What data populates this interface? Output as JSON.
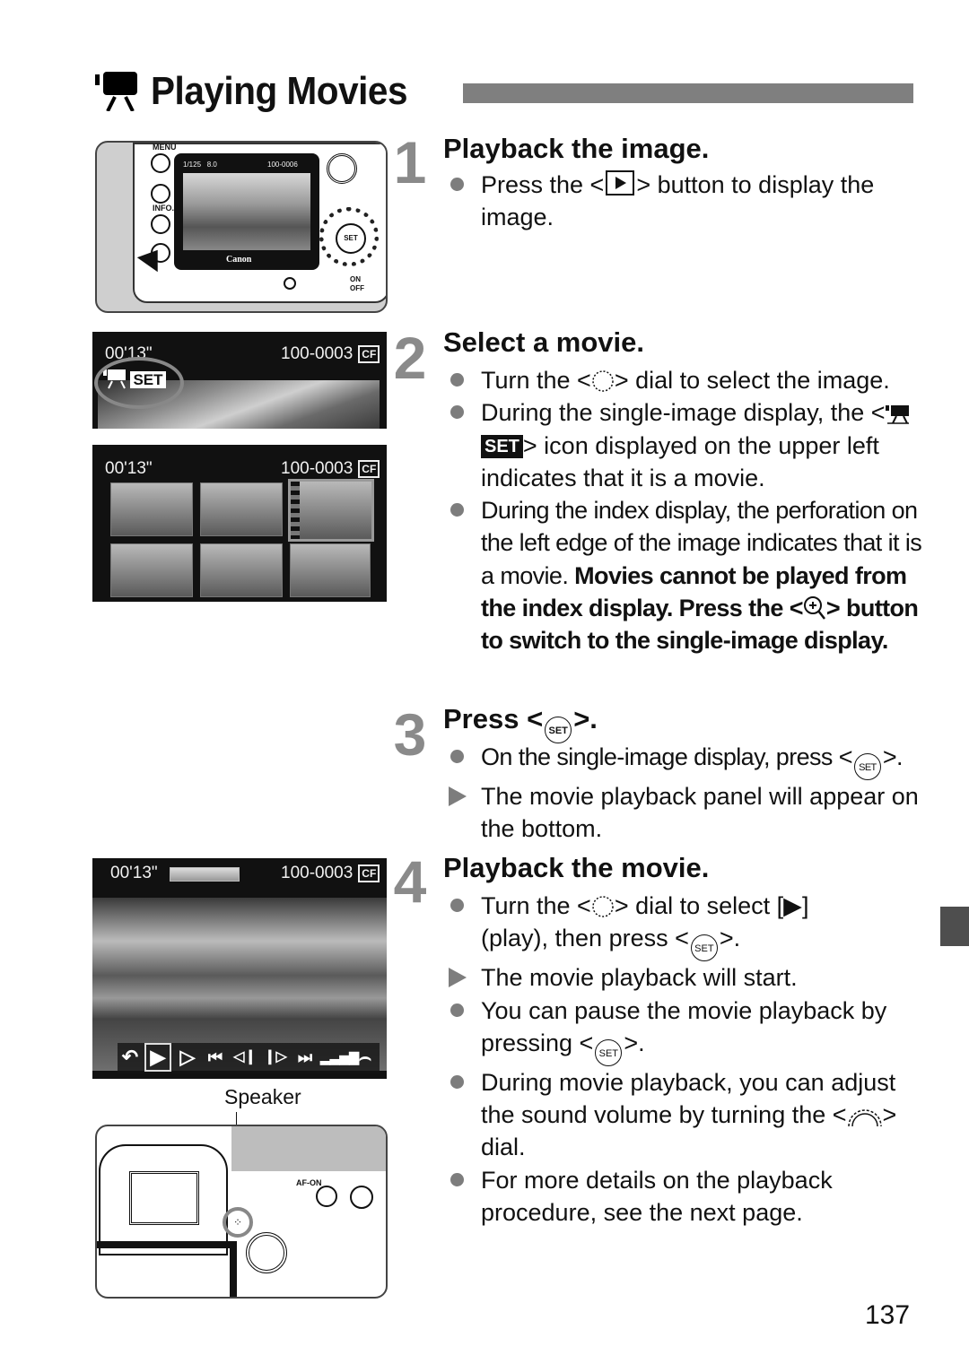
{
  "page": {
    "title": "Playing Movies",
    "title_icon": "movie-camera-icon",
    "page_number": "137",
    "accent_color": "#7f7f7f"
  },
  "steps": [
    {
      "number": "1",
      "heading": "Playback the image.",
      "items": [
        {
          "type": "bullet",
          "parts": [
            "Press the <",
            "play-button-icon",
            "> button to display the image."
          ]
        }
      ]
    },
    {
      "number": "2",
      "heading": "Select a movie.",
      "items": [
        {
          "type": "bullet",
          "parts": [
            "Turn the <",
            "quick-control-dial-icon",
            "> dial to select the image."
          ]
        },
        {
          "type": "bullet",
          "parts": [
            "During the single-image display, the <",
            "movie-set-icon",
            "> icon displayed on the upper left indicates that it is a movie."
          ]
        },
        {
          "type": "bullet",
          "text": "During the index display, the perforation on the left edge of the image indicates that it is a movie.",
          "bold_text_a": "Movies cannot be played from the index display. Press the <",
          "bold_text_b": "> button to switch to the single-image display."
        }
      ]
    },
    {
      "number": "3",
      "heading_a": "Press <",
      "heading_b": ">.",
      "items": [
        {
          "type": "bullet",
          "text_a": "On the single-image display, press <",
          "text_b": ">."
        },
        {
          "type": "arrow",
          "text": "The movie playback panel will appear on the bottom."
        }
      ]
    },
    {
      "number": "4",
      "heading": "Playback the movie.",
      "items": [
        {
          "type": "bullet",
          "text_a": "Turn the <",
          "text_b": "> dial to select [▶]",
          "text_c": "(play), then press <",
          "text_d": ">."
        },
        {
          "type": "arrow",
          "text": "The movie playback will start."
        },
        {
          "type": "bullet",
          "text_a": "You can pause the movie playback by",
          "text_b": "pressing <",
          "text_c": ">."
        },
        {
          "type": "bullet",
          "text_a": "During movie playback, you can adjust the sound volume by turning the <",
          "text_b": "> dial."
        },
        {
          "type": "bullet",
          "text": "For more details on the playback procedure, see the next page."
        }
      ]
    }
  ],
  "glyphs": {
    "set": "SET",
    "set_box": "SET"
  },
  "figures": {
    "camera_back": {
      "lcd_shutter": "1/125",
      "lcd_aperture": "8.0",
      "lcd_file": "100-0006",
      "brand": "Canon",
      "buttons": [
        "MENU",
        "INFO."
      ],
      "set_label": "SET",
      "power_on": "ON",
      "power_off": "OFF"
    },
    "single_display": {
      "duration": "00'13\"",
      "file": "100-0003",
      "card": "CF",
      "set_label": "SET"
    },
    "index_display": {
      "duration": "00'13\"",
      "file": "100-0003",
      "card": "CF"
    },
    "playback_panel": {
      "duration": "00'13\"",
      "file": "100-0003",
      "card": "CF",
      "progress": 0,
      "controls": [
        {
          "name": "exit",
          "glyph": "↶"
        },
        {
          "name": "play",
          "glyph": "▶",
          "selected": true
        },
        {
          "name": "slow-motion",
          "glyph": "▷"
        },
        {
          "name": "first-frame",
          "glyph": "⏮"
        },
        {
          "name": "previous-frame",
          "glyph": "◁❙"
        },
        {
          "name": "next-frame",
          "glyph": "❙▷"
        },
        {
          "name": "last-frame",
          "glyph": "⏭"
        },
        {
          "name": "volume",
          "glyph": "▂▃▅▇"
        },
        {
          "name": "edit",
          "glyph": "⌢"
        }
      ]
    },
    "speaker": {
      "label": "Speaker",
      "af_on": "AF-ON"
    }
  }
}
